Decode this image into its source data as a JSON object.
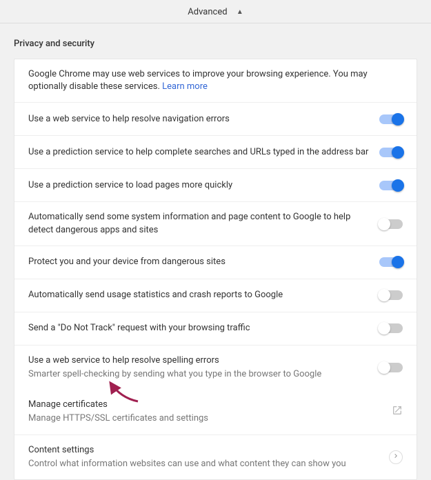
{
  "header": {
    "label": "Advanced"
  },
  "section": {
    "title": "Privacy and security"
  },
  "intro": {
    "text": "Google Chrome may use web services to improve your browsing experience. You may optionally disable these services. ",
    "link": "Learn more"
  },
  "rows": [
    {
      "label": "Use a web service to help resolve navigation errors",
      "on": true
    },
    {
      "label": "Use a prediction service to help complete searches and URLs typed in the address bar",
      "on": true
    },
    {
      "label": "Use a prediction service to load pages more quickly",
      "on": true
    },
    {
      "label": "Automatically send some system information and page content to Google to help detect dangerous apps and sites",
      "on": false
    },
    {
      "label": "Protect you and your device from dangerous sites",
      "on": true
    },
    {
      "label": "Automatically send usage statistics and crash reports to Google",
      "on": false
    },
    {
      "label": "Send a \"Do Not Track\" request with your browsing traffic",
      "on": false
    },
    {
      "label": "Use a web service to help resolve spelling errors",
      "sub": "Smarter spell-checking by sending what you type in the browser to Google",
      "on": false
    }
  ],
  "manage_certificates": {
    "label": "Manage certificates",
    "sub": "Manage HTTPS/SSL certificates and settings"
  },
  "content_settings": {
    "label": "Content settings",
    "sub": "Control what information websites can use and what content they can show you"
  }
}
